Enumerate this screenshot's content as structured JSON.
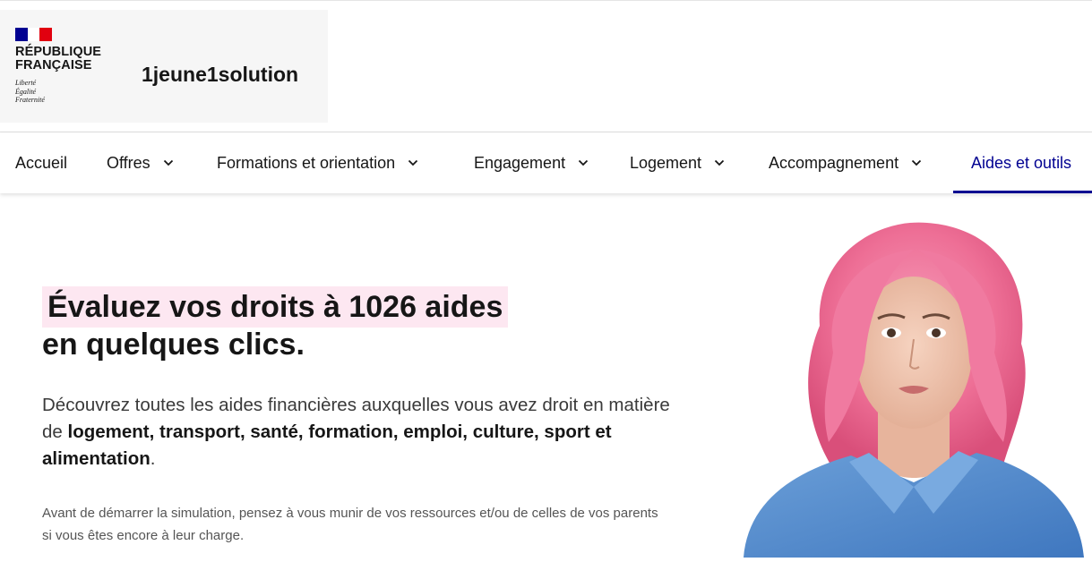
{
  "header": {
    "republique_lines": "RÉPUBLIQUE\nFRANÇAISE",
    "devise_lines": "Liberté\nÉgalité\nFraternité",
    "site_name": "1jeune1solution"
  },
  "nav": {
    "items": [
      {
        "label": "Accueil",
        "has_menu": false
      },
      {
        "label": "Offres",
        "has_menu": true
      },
      {
        "label": "Formations et orientation",
        "has_menu": true
      },
      {
        "label": "Engagement",
        "has_menu": true
      },
      {
        "label": "Logement",
        "has_menu": true
      },
      {
        "label": "Accompagnement",
        "has_menu": true
      },
      {
        "label": "Aides et outils",
        "has_menu": false,
        "active": true
      }
    ]
  },
  "hero": {
    "title_highlight": "Évaluez vos droits à 1026 aides",
    "title_rest": "en quelques clics.",
    "lead_start": "Découvrez toutes les aides financières auxquelles vous avez droit en matière de ",
    "lead_bold": "logement, transport, santé, formation, emploi, culture, sport et alimentation",
    "lead_end": ".",
    "note": "Avant de démarrer la simulation, pensez à vous munir de vos ressources et/ou de celles de vos parents si vous êtes encore à leur charge."
  },
  "colors": {
    "brand_blue": "#000091",
    "marianne_red": "#e1000f",
    "highlight_pink": "#fde7f1"
  },
  "icons": {
    "menu_toggle": "chevron-down-icon"
  }
}
